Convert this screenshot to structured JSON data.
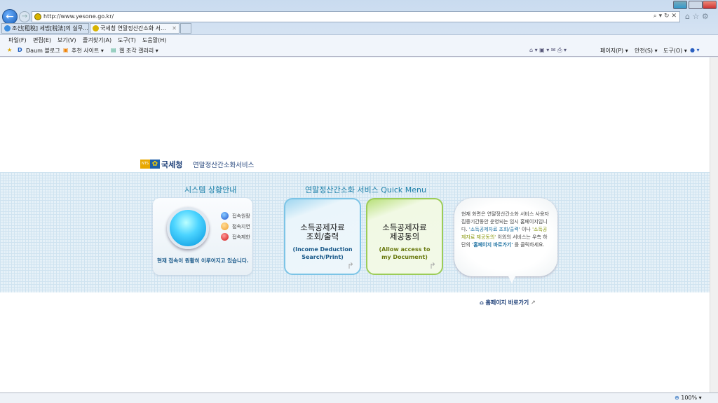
{
  "browser": {
    "url": "http://www.yesone.go.kr/",
    "zoom": "100%",
    "tabs": [
      {
        "label": "조선[租稅] 세법[稅法]의 실무..."
      },
      {
        "label": "국세청 연말정산간소화 서..."
      }
    ],
    "menu": [
      "파일(F)",
      "편집(E)",
      "보기(V)",
      "즐겨찾기(A)",
      "도구(T)",
      "도움말(H)"
    ],
    "favorites": [
      "Daum 블로그",
      "추천 사이트 ▾",
      "웹 조각 갤러리 ▾"
    ],
    "commands": [
      "페이지(P) ▾",
      "안전(S) ▾",
      "도구(O) ▾"
    ]
  },
  "page": {
    "logo": {
      "badge": "NTS",
      "name": "국세청"
    },
    "service_title": "연말정산간소화서비스",
    "status_section": {
      "title": "시스템 상황안내",
      "legend": [
        "접속원활",
        "접속지연",
        "접속제한"
      ],
      "message": "현재 접속이 원활히 이루어지고 있습니다."
    },
    "quick_menu": {
      "title": "연말정산간소화 서비스 Quick Menu",
      "cards": [
        {
          "ko1": "소득공제자료",
          "ko2": "조회/출력",
          "en1": "(Income Deduction",
          "en2": "Search/Print)"
        },
        {
          "ko1": "소득공제자료",
          "ko2": "제공동의",
          "en1": "(Allow access to",
          "en2": "my Document)"
        }
      ]
    },
    "notice": {
      "p1": "현재 화면은 연말정산간소화 서비스 사용자 집중기간동안 운영되는 임시 홈페이지입니다. ",
      "q1": "'소득공제자료 조회/출력'",
      "p2": " 이나 ",
      "q2": "'소득공제자료 제공동의'",
      "p3": " 이외의 서비스는 우측 하단의 ",
      "q3": "'홈페이지 바로가기'",
      "p4": " 를 클릭하세요."
    },
    "home_link": "홈페이지 바로가기"
  }
}
